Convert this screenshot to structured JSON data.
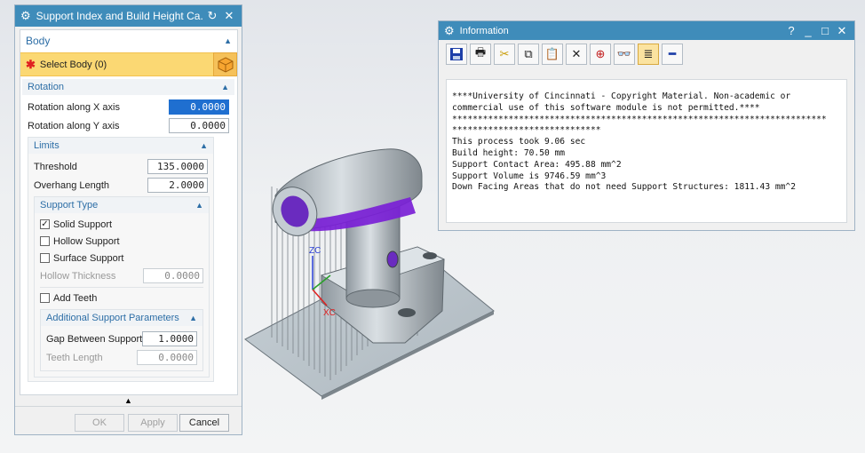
{
  "dialog": {
    "title": "Support Index and Build Height Ca...",
    "body_group": "Body",
    "select_body": "Select Body (0)",
    "rotation_group": "Rotation",
    "rot_x_label": "Rotation along X axis",
    "rot_x_value": "0.0000",
    "rot_y_label": "Rotation along Y axis",
    "rot_y_value": "0.0000",
    "limits_group": "Limits",
    "threshold_label": "Threshold",
    "threshold_value": "135.0000",
    "overhang_label": "Overhang Length",
    "overhang_value": "2.0000",
    "support_type_group": "Support Type",
    "solid_support": "Solid Support",
    "hollow_support": "Hollow Support",
    "surface_support": "Surface Support",
    "hollow_thickness_label": "Hollow Thickness",
    "hollow_thickness_value": "0.0000",
    "add_teeth": "Add Teeth",
    "additional_group": "Additional Support Parameters",
    "gap_label": "Gap Between Support",
    "gap_value": "1.0000",
    "teeth_length_label": "Teeth Length",
    "teeth_length_value": "0.0000",
    "ok": "OK",
    "apply": "Apply",
    "cancel": "Cancel",
    "solid_checked": true
  },
  "info": {
    "title": "Information",
    "text": "****University of Cincinnati - Copyright Material. Non-academic or\ncommercial use of this software module is not permitted.****\n*************************************************************************\n*****************************\nThis process took 9.06 sec\nBuild height: 70.50 mm\nSupport Contact Area: 495.88 mm^2\nSupport Volume is 9746.59 mm^3\nDown Facing Areas that do not need Support Structures: 1811.43 mm^2"
  },
  "viewport": {
    "axis_z": "ZC",
    "axis_x": "XC"
  },
  "colors": {
    "titlebar": "#3f8cba",
    "select_highlight": "#fbd873",
    "overhang_highlight": "#7a1fd6"
  }
}
